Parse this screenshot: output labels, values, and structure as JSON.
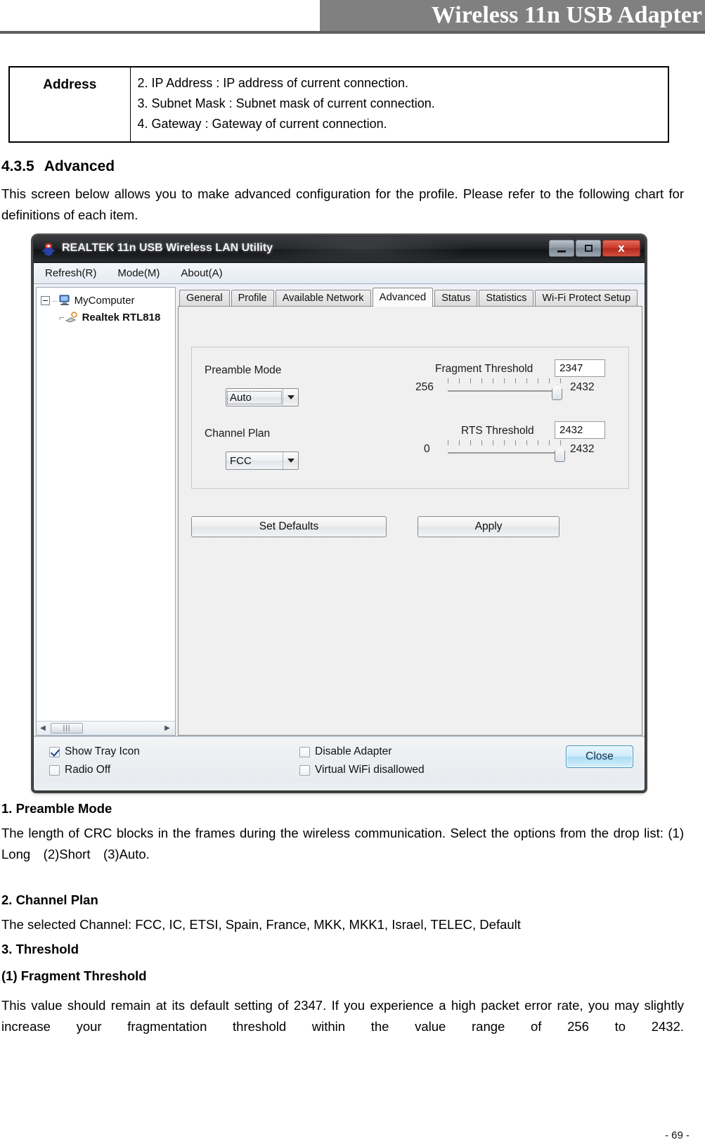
{
  "header": {
    "title": "Wireless 11n USB Adapter"
  },
  "address_table": {
    "label": "Address",
    "lines": [
      "2. IP Address : IP address of current connection.",
      "3. Subnet Mask : Subnet mask of current connection.",
      "4. Gateway : Gateway of current connection."
    ]
  },
  "section": {
    "number": "4.3.5",
    "title": "Advanced",
    "intro": "This screen below allows you to make advanced configuration for the profile. Please refer to the following chart for definitions of each item."
  },
  "app": {
    "titlebar": {
      "title": "REALTEK 11n USB Wireless LAN Utility",
      "minimize_label": "",
      "maximize_label": "",
      "close_label": "x"
    },
    "menu": [
      "Refresh(R)",
      "Mode(M)",
      "About(A)"
    ],
    "tree": {
      "root": "MyComputer",
      "child": "Realtek RTL818"
    },
    "tabs": [
      {
        "label": "General",
        "active": false
      },
      {
        "label": "Profile",
        "active": false
      },
      {
        "label": "Available Network",
        "active": false
      },
      {
        "label": "Advanced",
        "active": true
      },
      {
        "label": "Status",
        "active": false
      },
      {
        "label": "Statistics",
        "active": false
      },
      {
        "label": "Wi-Fi Protect Setup",
        "active": false
      }
    ],
    "advanced": {
      "preamble_mode_label": "Preamble Mode",
      "preamble_mode_value": "Auto",
      "channel_plan_label": "Channel Plan",
      "channel_plan_value": "FCC",
      "fragment_threshold_label": "Fragment Threshold",
      "fragment_threshold_value": "2347",
      "fragment_min": "256",
      "fragment_max": "2432",
      "rts_threshold_label": "RTS Threshold",
      "rts_threshold_value": "2432",
      "rts_min": "0",
      "rts_max": "2432",
      "set_defaults_label": "Set Defaults",
      "apply_label": "Apply"
    },
    "footer": {
      "show_tray_icon": "Show Tray Icon",
      "radio_off": "Radio Off",
      "disable_adapter": "Disable Adapter",
      "virtual_wifi_disallowed": "Virtual WiFi disallowed",
      "close_label": "Close"
    }
  },
  "notes": {
    "item1_title": "1. Preamble Mode",
    "item1_body": "The length of CRC blocks in the frames during the wireless communication. Select the options from the drop list: (1) Long (2)Short (3)Auto.",
    "item2_title": "2. Channel Plan",
    "item2_body": "The selected Channel: FCC, IC, ETSI, Spain, France, MKK, MKK1, Israel, TELEC, Default",
    "item3_title": "3. Threshold",
    "item3_sub1_title": "(1) Fragment Threshold",
    "item3_sub1_body": "This value should remain at its default setting of 2347. If you experience a high packet error rate, you may slightly increase your fragmentation threshold within the value range of 256 to 2432."
  },
  "page_footer": {
    "page_number": "- 69 -"
  },
  "colors": {
    "header_band": "#808080",
    "titlebar": "#1d1f22",
    "close_btn_red": "#c9392b",
    "close_button_blue": "#acdcf5",
    "checkbox_check": "#1b3f8f"
  }
}
